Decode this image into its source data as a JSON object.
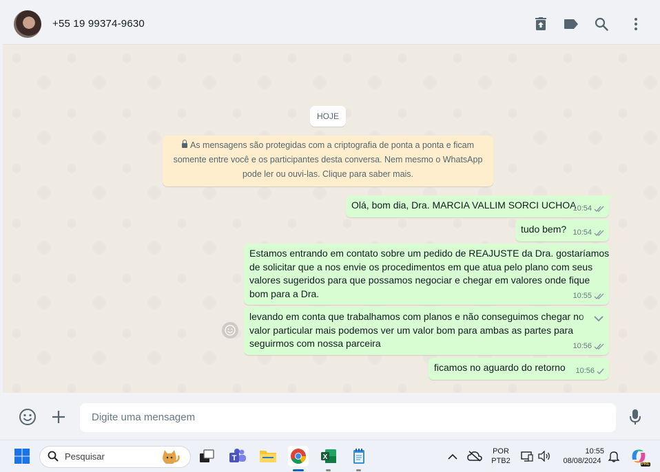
{
  "header": {
    "contact_name": "+55 19 99374-9630",
    "icons": [
      "archive-icon",
      "label-icon",
      "search-icon",
      "menu-icon"
    ]
  },
  "chat": {
    "date_chip": "HOJE",
    "encryption_notice": [
      "As mensagens são protegidas com a criptografia de ponta a ponta e ficam",
      "somente entre você e os participantes desta conversa. Nem mesmo o WhatsApp",
      "pode ler ou ouvi-las. Clique para saber mais."
    ],
    "messages": [
      {
        "text": "Olá, bom dia, Dra. MARCIA VALLIM SORCI UCHOA",
        "time": "10:54",
        "status": "read"
      },
      {
        "text": "tudo bem?",
        "time": "10:54",
        "status": "read"
      },
      {
        "text": "Estamos entrando em contato sobre um pedido de REAJUSTE da Dra. gostaríamos\nde solicitar que a nos envie os procedimentos em que atua pelo plano com seus\nvalores sugeridos para que possamos negociar e chegar em valores onde fique\nbom para a Dra.",
        "time": "10:55",
        "status": "read"
      },
      {
        "text": "levando em conta que trabalhamos com planos e não conseguimos chegar no\nvalor particular mais podemos ver um valor bom para ambas as partes para\nseguirmos com nossa parceira",
        "time": "10:56",
        "status": "read"
      },
      {
        "text": "ficamos no aguardo do retorno",
        "time": "10:56",
        "status": "delivered"
      }
    ]
  },
  "composer": {
    "placeholder": "Digite uma mensagem"
  },
  "taskbar": {
    "search_label": "Pesquisar",
    "language_line1": "POR",
    "language_line2": "PTB2",
    "time": "10:55",
    "date": "08/08/2024",
    "copilot_badge": "PRE"
  },
  "colors": {
    "outgoing_bubble": "#d9fdd3",
    "chat_background": "#efeae2",
    "read_check": "#53bdeb"
  }
}
